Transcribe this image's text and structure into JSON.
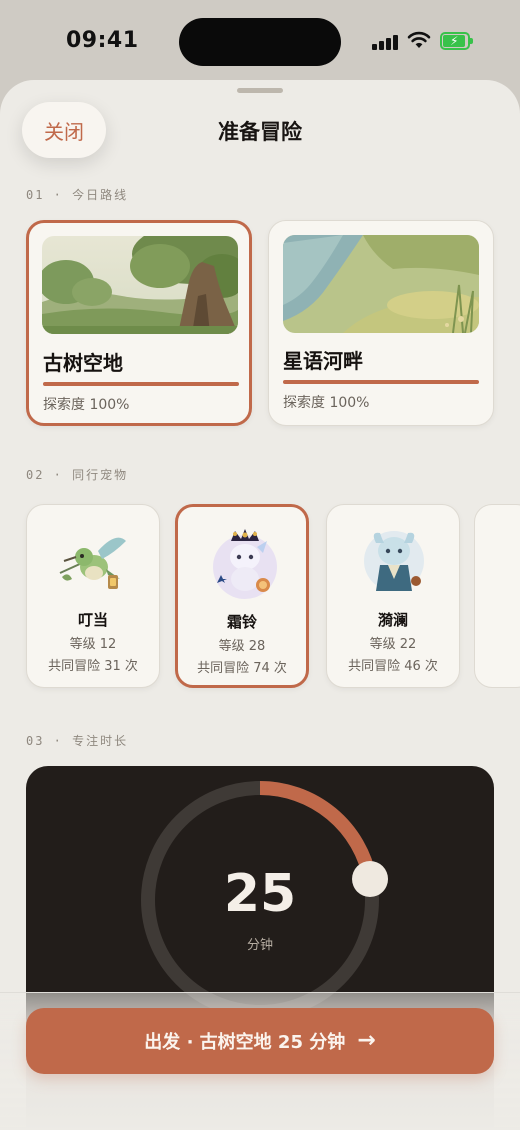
{
  "status_bar": {
    "time": "09:41"
  },
  "header": {
    "close_label": "关闭",
    "title": "准备冒险"
  },
  "sections": {
    "route_label": "01 · 今日路线",
    "pet_label": "02 · 同行宠物",
    "focus_label": "03 · 专注时长"
  },
  "routes": [
    {
      "name": "古树空地",
      "progress_text": "探索度 100%",
      "progress": 1.0,
      "selected": true
    },
    {
      "name": "星语河畔",
      "progress_text": "探索度 100%",
      "progress": 1.0,
      "selected": false
    }
  ],
  "pets": [
    {
      "name": "叮当",
      "level": "等级 12",
      "adventures": "共同冒险 31 次",
      "selected": false
    },
    {
      "name": "霜铃",
      "level": "等级 28",
      "adventures": "共同冒险 74 次",
      "selected": true
    },
    {
      "name": "漪澜",
      "level": "等级 22",
      "adventures": "共同冒险 46 次",
      "selected": false
    }
  ],
  "timer": {
    "value": "25",
    "unit": "分钟",
    "progress": 0.22
  },
  "cta": {
    "label": "出发 · 古树空地 25 分钟",
    "arrow": "→"
  },
  "colors": {
    "accent": "#c0694a",
    "sheet_bg": "#edebe6",
    "card_bg": "#f8f6f1",
    "timer_bg": "#221d1a",
    "ring_track": "#3f3a36",
    "battery": "#38c24a"
  },
  "icons": [
    "signal-icon",
    "wifi-icon",
    "battery-charging-icon",
    "arrow-right-icon"
  ]
}
